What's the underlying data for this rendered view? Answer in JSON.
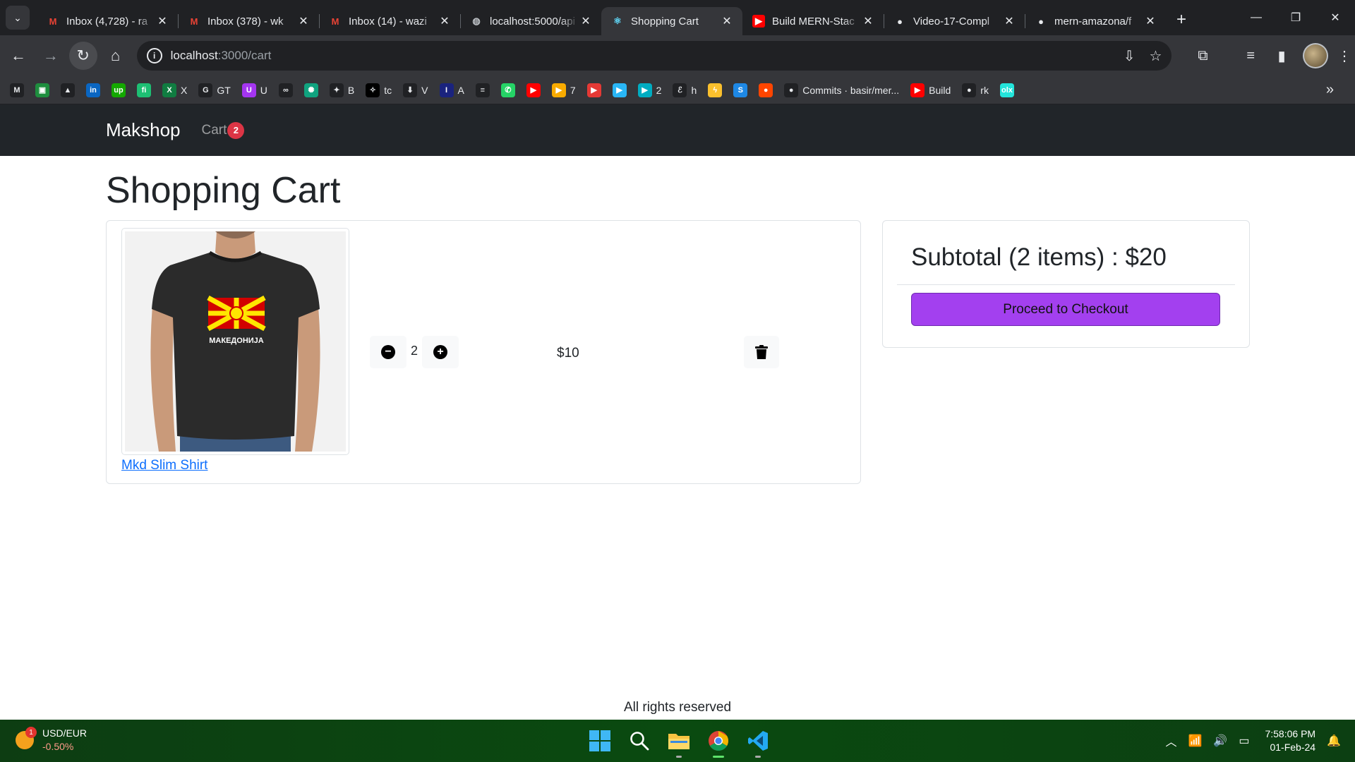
{
  "browser": {
    "tabs": [
      {
        "title": "Inbox (4,728) - ra",
        "favicon": "gmail-icon",
        "active": false
      },
      {
        "title": "Inbox (378) - wk",
        "favicon": "gmail-icon",
        "active": false
      },
      {
        "title": "Inbox (14) - wazi",
        "favicon": "gmail-icon",
        "active": false
      },
      {
        "title": "localhost:5000/api",
        "favicon": "globe-icon",
        "active": false
      },
      {
        "title": "Shopping Cart",
        "favicon": "react-icon",
        "active": true
      },
      {
        "title": "Build MERN-Stac",
        "favicon": "youtube-icon",
        "active": false
      },
      {
        "title": "Video-17-Compl",
        "favicon": "github-icon",
        "active": false
      },
      {
        "title": "mern-amazona/f",
        "favicon": "github-icon",
        "active": false
      }
    ],
    "url_host": "localhost",
    "url_path": ":3000/cart",
    "bookmarks": [
      {
        "label": "",
        "icon": "gmail-icon",
        "color": "#202124"
      },
      {
        "label": "",
        "icon": "classroom-icon",
        "color": "#1e8e3e"
      },
      {
        "label": "",
        "icon": "drive-icon",
        "color": "#202124"
      },
      {
        "label": "",
        "icon": "linkedin-icon",
        "color": "#0a66c2"
      },
      {
        "label": "",
        "icon": "upwork-icon",
        "color": "#14a800"
      },
      {
        "label": "",
        "icon": "fiverr-icon",
        "color": "#1dbf73"
      },
      {
        "label": "X",
        "icon": "excel-icon",
        "color": "#107c41"
      },
      {
        "label": "GT",
        "icon": "google-translate-icon",
        "color": "#202124"
      },
      {
        "label": "U",
        "icon": "udemy-icon",
        "color": "#a435f0"
      },
      {
        "label": "",
        "icon": "infinity-icon",
        "color": "#202124"
      },
      {
        "label": "",
        "icon": "chatgpt-icon",
        "color": "#10a37f"
      },
      {
        "label": "B",
        "icon": "bard-icon",
        "color": "#202124"
      },
      {
        "label": "tc",
        "icon": "sparkle-icon",
        "color": "#000000"
      },
      {
        "label": "V",
        "icon": "download-icon",
        "color": "#202124"
      },
      {
        "label": "A",
        "icon": "italic-icon",
        "color": "#1a237e"
      },
      {
        "label": "",
        "icon": "bar-icon",
        "color": "#202124"
      },
      {
        "label": "",
        "icon": "whatsapp-icon",
        "color": "#25d366"
      },
      {
        "label": "",
        "icon": "youtube-icon",
        "color": "#ff0000"
      },
      {
        "label": "7",
        "icon": "play-folder-icon",
        "color": "#f9ab00"
      },
      {
        "label": "",
        "icon": "play-red-icon",
        "color": "#e53935"
      },
      {
        "label": "",
        "icon": "play-blue-icon",
        "color": "#29b6f6"
      },
      {
        "label": "2",
        "icon": "play-teal-icon",
        "color": "#00acc1"
      },
      {
        "label": "h",
        "icon": "script-e-icon",
        "color": "#202124"
      },
      {
        "label": "",
        "icon": "lightning-icon",
        "color": "#fbc02d"
      },
      {
        "label": "",
        "icon": "s-icon",
        "color": "#1e88e5"
      },
      {
        "label": "",
        "icon": "reddit-icon",
        "color": "#ff4500"
      },
      {
        "label": "Commits · basir/mer...",
        "icon": "github-icon",
        "color": "#202124"
      },
      {
        "label": "Build",
        "icon": "youtube-icon",
        "color": "#ff0000"
      },
      {
        "label": "rk",
        "icon": "github-icon",
        "color": "#202124"
      },
      {
        "label": "",
        "icon": "olx-icon",
        "color": "#23e5db"
      }
    ]
  },
  "site": {
    "brand": "Makshop",
    "cart_label": "Cart",
    "cart_count": "2",
    "page_title": "Shopping Cart",
    "items": [
      {
        "name": "Mkd Slim Shirt",
        "quantity": "2",
        "price": "$10",
        "shirt_text": "МАКЕДОНИЈА"
      }
    ],
    "subtotal": "Subtotal (2 items) : $20",
    "checkout_label": "Proceed to Checkout",
    "footer": "All rights reserved",
    "colors": {
      "navbar": "#212529",
      "badge": "#dc3545",
      "checkout": "#a340ef",
      "link": "#0d6efd"
    }
  },
  "taskbar": {
    "widget_title": "USD/EUR",
    "widget_change": "-0.50%",
    "widget_badge": "1",
    "time": "7:58:06 PM",
    "date": "01-Feb-24"
  }
}
